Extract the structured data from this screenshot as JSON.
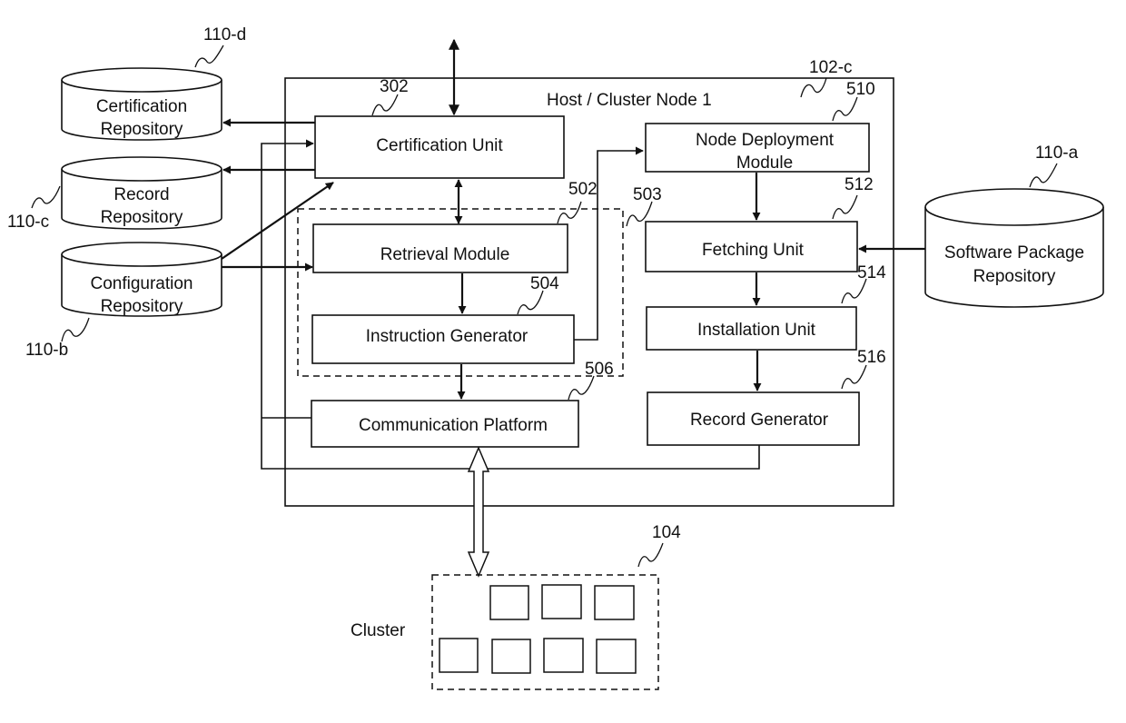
{
  "host": {
    "title": "Host / Cluster Node 1",
    "ref": "102-c"
  },
  "repositories": {
    "certification": {
      "line1": "Certification",
      "line2": "Repository",
      "ref": "110-d"
    },
    "record": {
      "line1": "Record",
      "line2": "Repository",
      "ref": "110-c"
    },
    "configuration": {
      "line1": "Configuration",
      "line2": "Repository",
      "ref": "110-b"
    },
    "software": {
      "line1": "Software Package",
      "line2": "Repository",
      "ref": "110-a"
    }
  },
  "units": {
    "certification_unit": {
      "label": "Certification Unit",
      "ref": "302"
    },
    "retrieval_module": {
      "label": "Retrieval Module",
      "ref": "502"
    },
    "group": {
      "ref": "503"
    },
    "instruction_generator": {
      "label": "Instruction Generator",
      "ref": "504"
    },
    "communication_platform": {
      "label": "Communication Platform",
      "ref": "506"
    },
    "node_deployment": {
      "line1": "Node Deployment",
      "line2": "Module",
      "ref": "510"
    },
    "fetching_unit": {
      "label": "Fetching Unit",
      "ref": "512"
    },
    "installation_unit": {
      "label": "Installation Unit",
      "ref": "514"
    },
    "record_generator": {
      "label": "Record Generator",
      "ref": "516"
    }
  },
  "cluster": {
    "label": "Cluster",
    "ref": "104",
    "node_count": 7
  }
}
